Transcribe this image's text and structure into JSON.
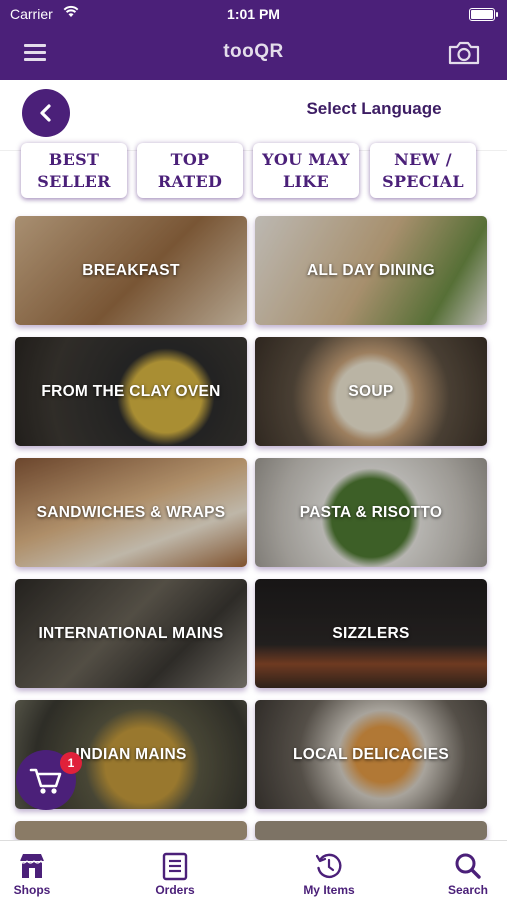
{
  "status_bar": {
    "carrier": "Carrier",
    "time": "1:01 PM"
  },
  "navbar": {
    "title": "tooQR",
    "menu_icon": "hamburger-icon",
    "camera_icon": "camera-icon"
  },
  "header": {
    "select_language": "Select Language",
    "back_icon": "chevron-left-icon"
  },
  "filter_chips": [
    {
      "label": "BEST\nSELLER"
    },
    {
      "label": "TOP\nRATED"
    },
    {
      "label": "YOU MAY\nLIKE"
    },
    {
      "label": "NEW /\nSPECIAL"
    }
  ],
  "categories": [
    {
      "label": "BREAKFAST",
      "color": "#b8916a"
    },
    {
      "label": "ALL DAY DINING",
      "color": "#d9c3a2"
    },
    {
      "label": "FROM THE CLAY OVEN",
      "color": "#3a3a3a"
    },
    {
      "label": "SOUP",
      "color": "#7a6a55"
    },
    {
      "label": "SANDWICHES & WRAPS",
      "color": "#c69b66"
    },
    {
      "label": "PASTA & RISOTTO",
      "color": "#6d8c55"
    },
    {
      "label": "INTERNATIONAL MAINS",
      "color": "#4a4a44"
    },
    {
      "label": "SIZZLERS",
      "color": "#24201f"
    },
    {
      "label": "INDIAN MAINS",
      "color": "#7b6c48"
    },
    {
      "label": "LOCAL DELICACIES",
      "color": "#5a5148"
    }
  ],
  "cart": {
    "badge_count": "1",
    "icon": "cart-icon"
  },
  "tab_bar": [
    {
      "label": "Shops",
      "icon": "shop-icon"
    },
    {
      "label": "Orders",
      "icon": "orders-icon"
    },
    {
      "label": "My Items",
      "icon": "history-icon"
    },
    {
      "label": "Search",
      "icon": "search-icon"
    }
  ],
  "colors": {
    "brand": "#4b2079",
    "badge": "#e0213a"
  }
}
